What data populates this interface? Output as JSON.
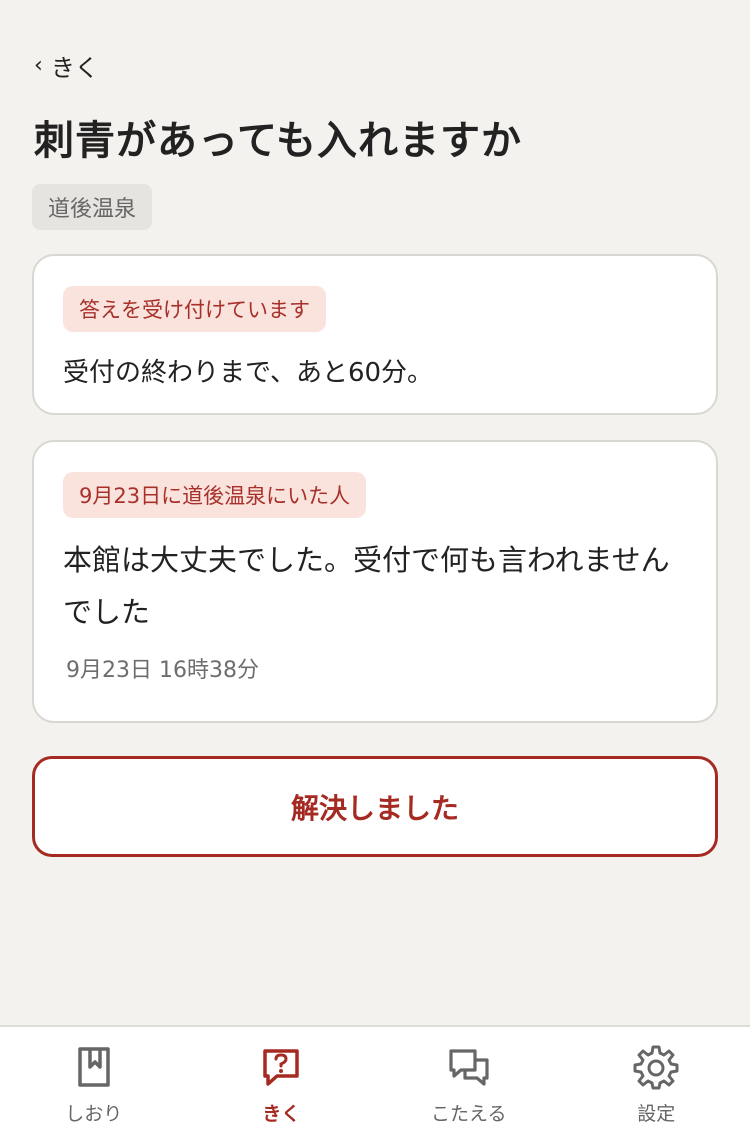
{
  "header": {
    "back_label": "きく",
    "title": "刺青があっても入れますか",
    "place_tag": "道後温泉"
  },
  "status_card": {
    "badge": "答えを受け付けています",
    "text": "受付の終わりまで、あと60分。"
  },
  "answer_card": {
    "badge": "9月23日に道後温泉にいた人",
    "text": "本館は大丈夫でした。受付で何も言われませんでした",
    "timestamp": "9月23日 16時38分"
  },
  "resolve_button": {
    "label": "解決しました"
  },
  "tabbar": {
    "items": [
      {
        "label": "しおり",
        "icon": "bookmark-icon",
        "active": false
      },
      {
        "label": "きく",
        "icon": "question-bubble-icon",
        "active": true
      },
      {
        "label": "こたえる",
        "icon": "chat-bubbles-icon",
        "active": false
      },
      {
        "label": "設定",
        "icon": "gear-icon",
        "active": false
      }
    ]
  },
  "colors": {
    "accent": "#a52a22",
    "badge_bg": "#f9e3dc",
    "page_bg": "#f4f2ee",
    "inactive": "#666666"
  }
}
